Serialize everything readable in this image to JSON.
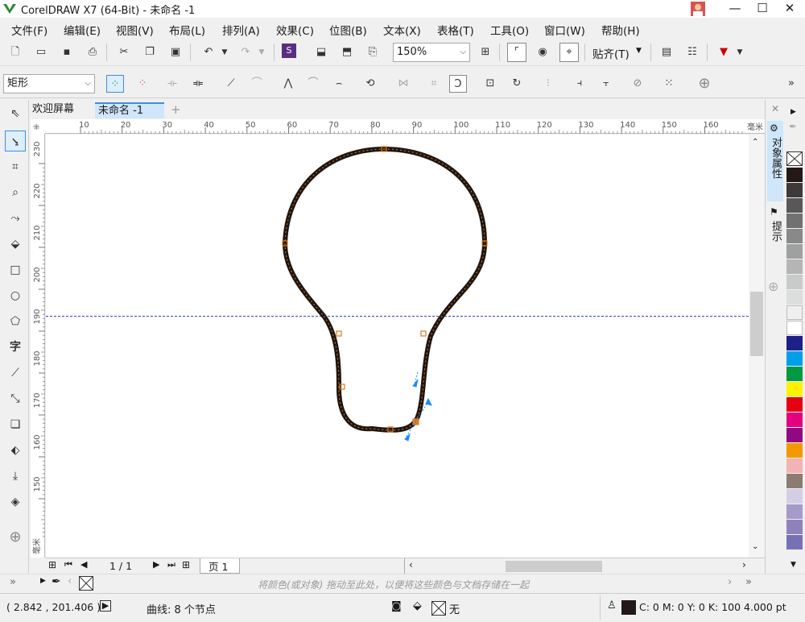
{
  "window": {
    "title": "CorelDRAW X7 (64-Bit) - 未命名 -1",
    "minimize": "—",
    "maximize": "☐",
    "close": "✕"
  },
  "menu": [
    "文件(F)",
    "编辑(E)",
    "视图(V)",
    "布局(L)",
    "排列(A)",
    "效果(C)",
    "位图(B)",
    "文本(X)",
    "表格(T)",
    "工具(O)",
    "窗口(W)",
    "帮助(H)"
  ],
  "toolbar": {
    "zoom": "150%",
    "snap": "贴齐(T)"
  },
  "propertybar": {
    "shape_type": "矩形"
  },
  "tabs": {
    "welcome": "欢迎屏幕",
    "doc": "未命名 -1",
    "add": "+"
  },
  "ruler": {
    "unit": "毫米",
    "top_ticks": [
      "10",
      "20",
      "30",
      "40",
      "50",
      "60",
      "70",
      "80",
      "90",
      "100",
      "110",
      "120",
      "130",
      "140",
      "150",
      "160"
    ],
    "left_ticks": [
      "230",
      "220",
      "210",
      "200",
      "190",
      "180",
      "170",
      "160",
      "150"
    ],
    "left_unit": "毫米"
  },
  "pagenav": {
    "current": "1 / 1",
    "page_tab": "页 1"
  },
  "colorhint": {
    "text": "将颜色(或对象) 拖动至此处，以便将这些颜色与文档存储在一起"
  },
  "status": {
    "coords": "( 2.842 , 201.406 )",
    "info": "曲线: 8 个节点",
    "fill_none": "无",
    "outline": "C: 0 M: 0 Y: 0 K: 100  4.000 pt"
  },
  "dock": {
    "obj_props": "对象属性",
    "hints": "提示"
  },
  "palette": [
    "#231815",
    "#3e3a39",
    "#595757",
    "#727171",
    "#898989",
    "#9fa0a0",
    "#b5b5b6",
    "#c9caca",
    "#dcdddd",
    "#efefef",
    "#ffffff",
    "#1d2088",
    "#00a0e9",
    "#009944",
    "#fff100",
    "#e60012",
    "#e4007f",
    "#920783",
    "#f39800",
    "#f5b2b2",
    "#8c7c6f",
    "#d3cde6",
    "#a59aca",
    "#8f82bc",
    "#7671b6"
  ]
}
